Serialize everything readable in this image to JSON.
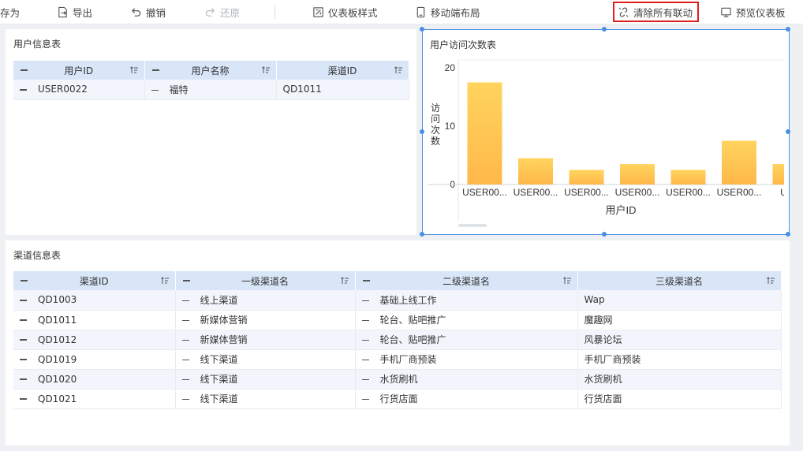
{
  "toolbar": {
    "saveas_label": "存为",
    "export_label": "导出",
    "undo_label": "撤销",
    "redo_label": "还原",
    "style_label": "仪表板样式",
    "mobile_label": "移动端布局",
    "clear_links_label": "清除所有联动",
    "preview_label": "预览仪表板"
  },
  "user_table": {
    "title": "用户信息表",
    "columns": [
      "用户ID",
      "用户名称",
      "渠道ID"
    ],
    "rows": [
      [
        "USER0022",
        "福特",
        "QD1011"
      ]
    ]
  },
  "chart": {
    "title": "用户访问次数表",
    "colors": {
      "bar_top": "#ffd45e",
      "bar_bottom": "#ffb84a",
      "selection": "#4a90e2"
    }
  },
  "chart_data": {
    "type": "bar",
    "xlabel": "用户ID",
    "ylabel": "访问次数",
    "y_ticks": [
      "20",
      "10",
      "0"
    ],
    "ylim": [
      0,
      20
    ],
    "categories": [
      "USER00...",
      "USER00...",
      "USER00...",
      "USER00...",
      "USER00...",
      "USER00...",
      "USE"
    ],
    "values": [
      17.5,
      4.5,
      2.5,
      3.5,
      2.5,
      7.5,
      3.5
    ]
  },
  "channel_table": {
    "title": "渠道信息表",
    "columns": [
      "渠道ID",
      "一级渠道名",
      "二级渠道名",
      "三级渠道名"
    ],
    "rows": [
      [
        "QD1003",
        "线上渠道",
        "基础上线工作",
        "Wap"
      ],
      [
        "QD1011",
        "新媒体营销",
        "轮台、贴吧推广",
        "魔趣网"
      ],
      [
        "QD1012",
        "新媒体营销",
        "轮台、贴吧推广",
        "风暴论坛"
      ],
      [
        "QD1019",
        "线下渠道",
        "手机厂商预装",
        "手机厂商预装"
      ],
      [
        "QD1020",
        "线下渠道",
        "水货刷机",
        "水货刷机"
      ],
      [
        "QD1021",
        "线下渠道",
        "行货店面",
        "行货店面"
      ]
    ]
  }
}
